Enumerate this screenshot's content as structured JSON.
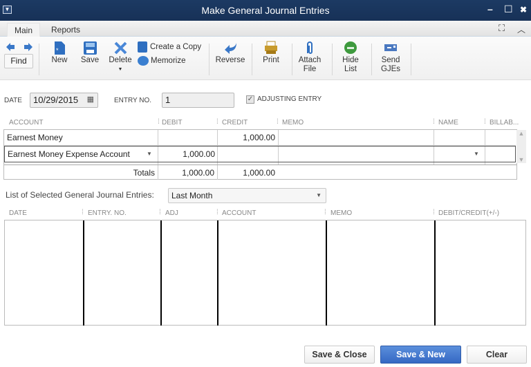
{
  "window": {
    "title": "Make General Journal Entries",
    "minimize": "–",
    "maximize": "☐",
    "close": "✖"
  },
  "tabs": [
    {
      "label": "Main",
      "active": true
    },
    {
      "label": "Reports",
      "active": false
    }
  ],
  "toolbar": {
    "find": "Find",
    "new": "New",
    "save": "Save",
    "delete": "Delete",
    "create_copy": "Create a Copy",
    "memorize": "Memorize",
    "reverse": "Reverse",
    "print": "Print",
    "attach_file_1": "Attach",
    "attach_file_2": "File",
    "hide_list_1": "Hide",
    "hide_list_2": "List",
    "send_gjes_1": "Send",
    "send_gjes_2": "GJEs"
  },
  "form": {
    "date_label": "DATE",
    "date_value": "10/29/2015",
    "entry_no_label": "ENTRY NO.",
    "entry_no_value": "1",
    "adjusting_label": "ADJUSTING ENTRY",
    "adjusting_checked": true
  },
  "grid": {
    "headers": [
      "ACCOUNT",
      "DEBIT",
      "CREDIT",
      "MEMO",
      "NAME",
      "BILLAB..."
    ],
    "rows": [
      {
        "account": "Earnest Money",
        "debit": "",
        "credit": "1,000.00",
        "memo": "",
        "name": "",
        "billable": ""
      },
      {
        "account": "Earnest Money Expense Account",
        "debit": "1,000.00",
        "credit": "",
        "memo": "",
        "name": "",
        "billable": ""
      }
    ],
    "totals_label": "Totals",
    "total_debit": "1,000.00",
    "total_credit": "1,000.00"
  },
  "list": {
    "label": "List of Selected General Journal Entries:",
    "filter": "Last Month",
    "headers": [
      "DATE",
      "ENTRY. NO.",
      "ADJ",
      "ACCOUNT",
      "MEMO",
      "DEBIT/CREDIT(+/-)"
    ]
  },
  "buttons": {
    "save_close": "Save & Close",
    "save_new": "Save & New",
    "clear": "Clear"
  }
}
